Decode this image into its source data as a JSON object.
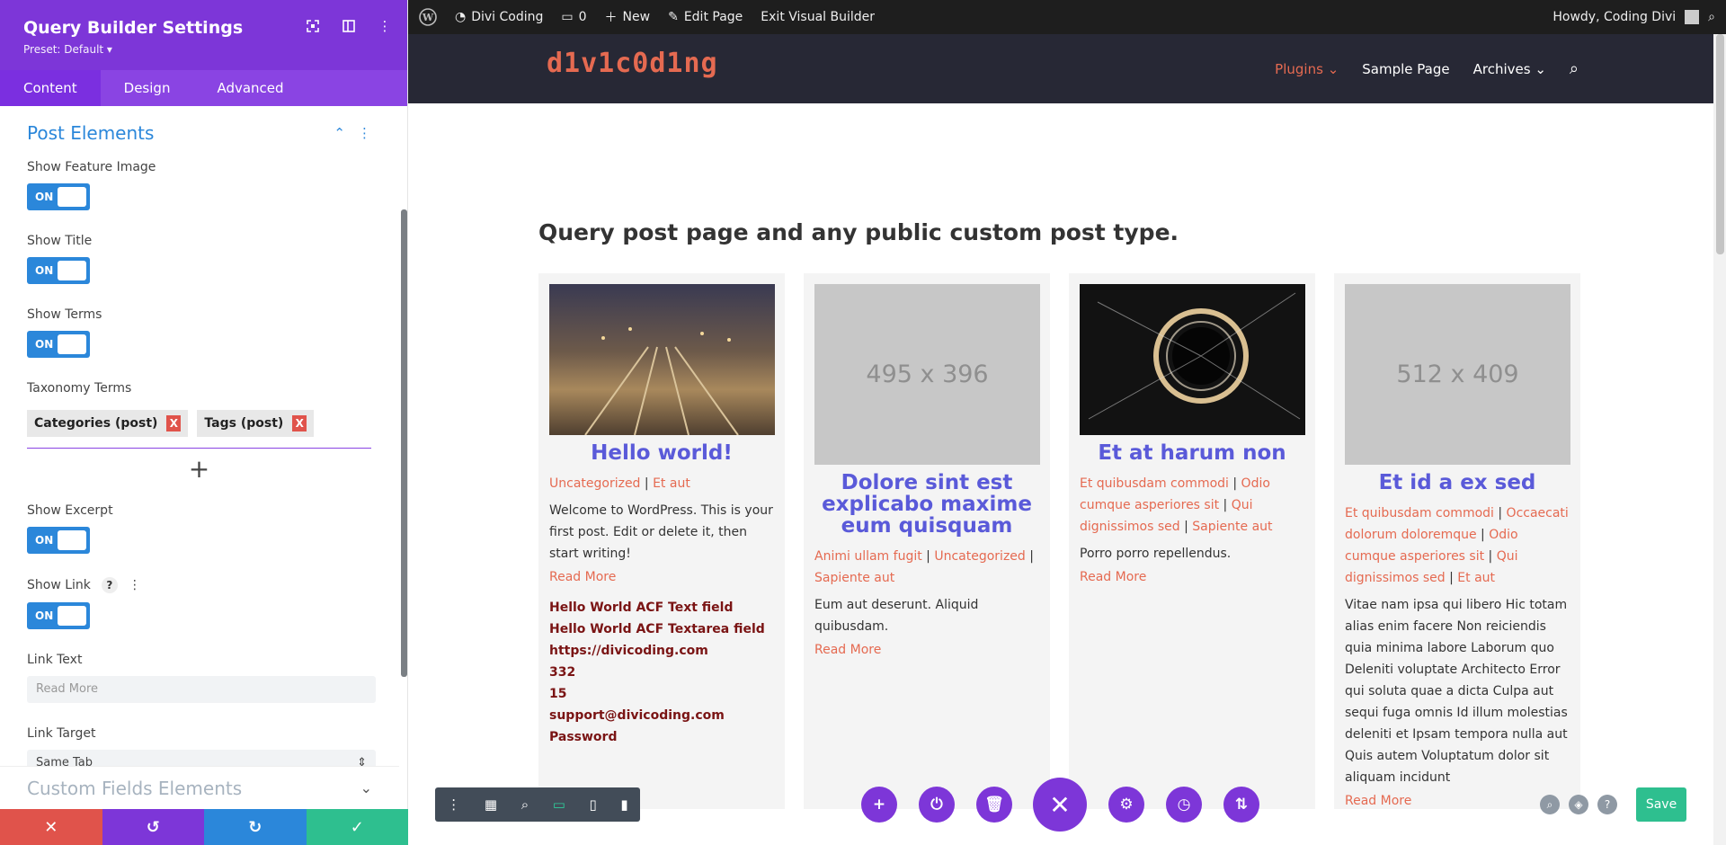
{
  "panel": {
    "title": "Query Builder Settings",
    "preset": "Preset: Default ▾",
    "tabs": [
      "Content",
      "Design",
      "Advanced"
    ],
    "section_title": "Post Elements",
    "fields": {
      "show_feature_image": "Show Feature Image",
      "show_title": "Show Title",
      "show_terms": "Show Terms",
      "taxonomy_terms": "Taxonomy Terms",
      "show_excerpt": "Show Excerpt",
      "show_link": "Show Link",
      "link_text": "Link Text",
      "link_target": "Link Target"
    },
    "toggle_on": "ON",
    "taxonomy_chips": [
      "Categories (post)",
      "Tags (post)"
    ],
    "chip_remove": "X",
    "link_text_placeholder": "Read More",
    "link_target_value": "Same Tab",
    "help_glyph": "?",
    "section2_title": "Custom Fields Elements"
  },
  "adminbar": {
    "site_name": "Divi Coding",
    "comments_count": "0",
    "new_label": "New",
    "edit_page": "Edit Page",
    "exit_builder": "Exit Visual Builder",
    "greeting": "Howdy, Coding Divi"
  },
  "site": {
    "logo": "d1v1c0d1ng",
    "nav": [
      "Plugins",
      "Sample Page",
      "Archives"
    ]
  },
  "page": {
    "heading": "Query post page and any public custom post type.",
    "read_more": "Read More",
    "cards": [
      {
        "title": "Hello world!",
        "image_placeholder": "",
        "terms": [
          "Uncategorized",
          "Et aut"
        ],
        "excerpt": "Welcome to WordPress. This is your first post. Edit or delete it, then start writing!",
        "acf": [
          "Hello World ACF Text field",
          "Hello World ACF Textarea field",
          "https://divicoding.com",
          "332",
          "15",
          "support@divicoding.com",
          "Password"
        ]
      },
      {
        "title": "Dolore sint est explicabo maxime eum quisquam",
        "image_placeholder": "495 x 396",
        "terms": [
          "Animi ullam fugit",
          "Uncategorized",
          "Sapiente aut"
        ],
        "excerpt": "Eum aut deserunt. Aliquid quibusdam."
      },
      {
        "title": "Et at harum non",
        "image_placeholder": "",
        "terms": [
          "Et quibusdam commodi",
          "Odio cumque asperiores sit",
          "Qui dignissimos sed",
          "Sapiente aut"
        ],
        "excerpt": "Porro porro repellendus."
      },
      {
        "title": "Et id a ex sed",
        "image_placeholder": "512 x 409",
        "terms": [
          "Et quibusdam commodi",
          "Occaecati dolorum doloremque",
          "Odio cumque asperiores sit",
          "Qui dignissimos sed",
          "Et aut"
        ],
        "excerpt": "Vitae nam ipsa qui libero Hic totam alias enim facere Non reiciendis quia minima labore Laborum quo Deleniti voluptate Architecto Error qui soluta quae a dicta Culpa aut sequi fuga omnis Id illum molestias deleniti et Ipsam tempora nulla aut Quis autem Voluptatum dolor sit aliquam incidunt"
      }
    ]
  },
  "builder": {
    "save": "Save"
  },
  "colors": {
    "panel_purple": "#7d36d8",
    "accent_blue": "#2b87da",
    "link_orange": "#e56a51",
    "title_blue": "#5a5ad9",
    "acf_red": "#7a1414",
    "save_green": "#2ebf8f"
  }
}
